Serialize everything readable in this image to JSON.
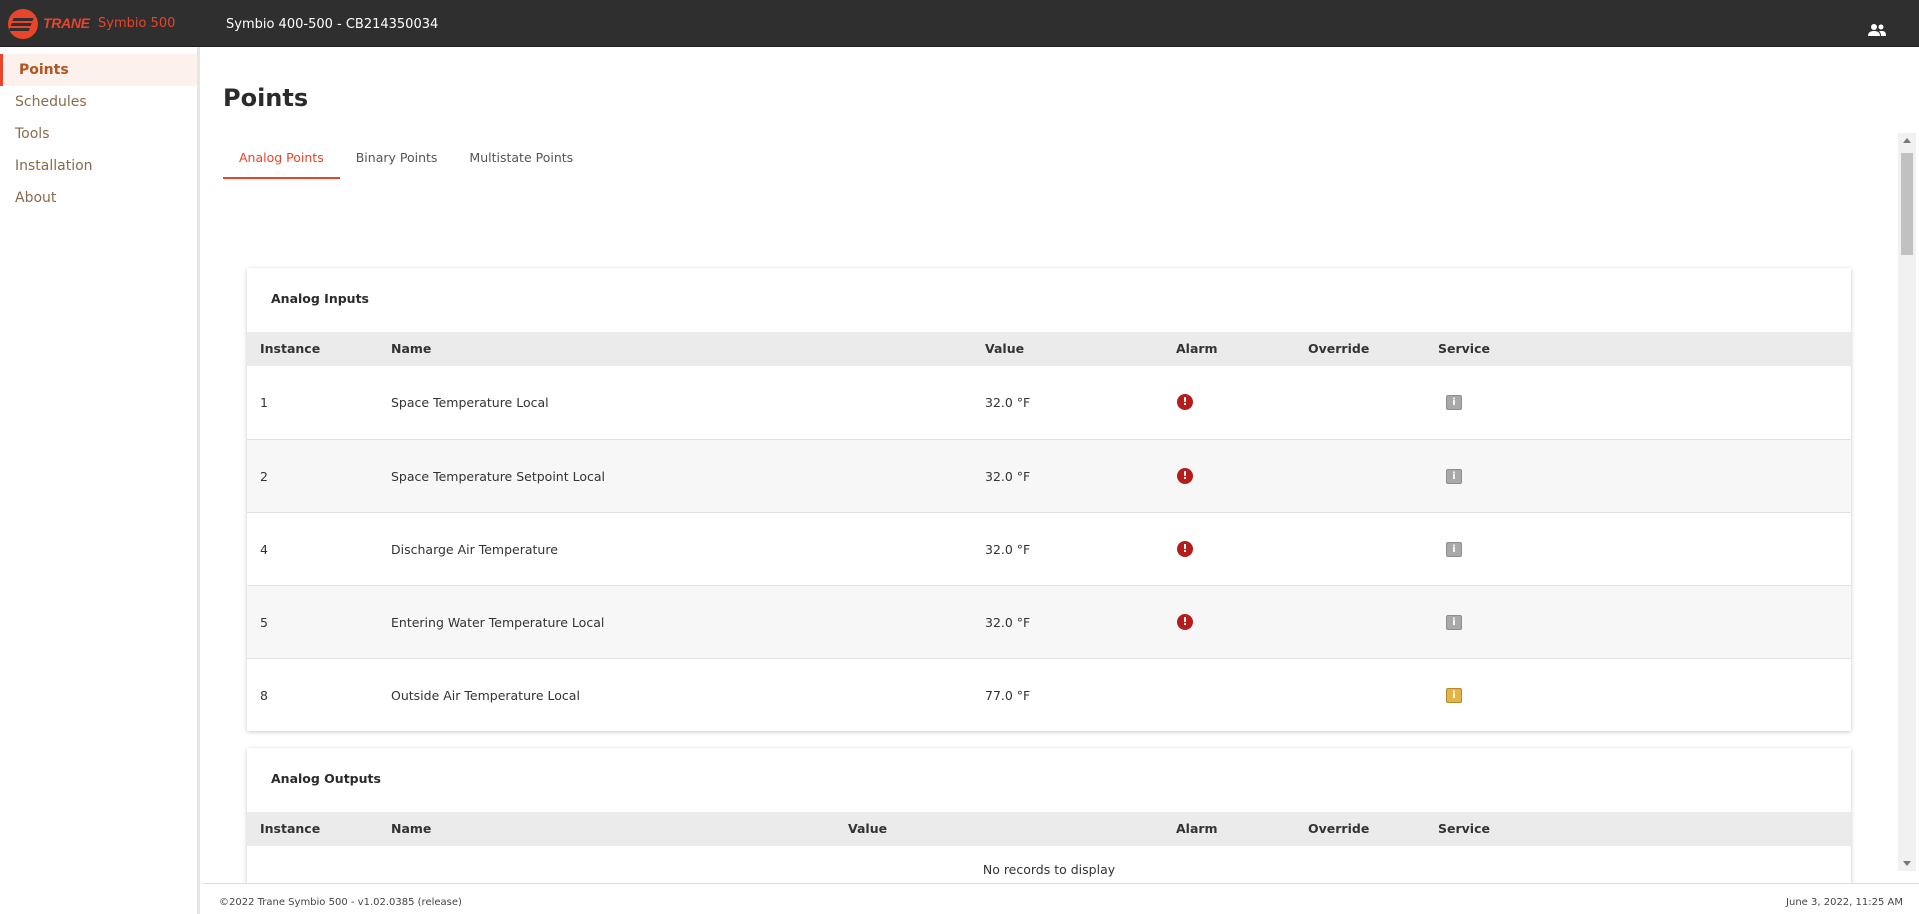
{
  "header": {
    "brand": "TRANE",
    "product": "Symbio 500",
    "device_title": "Symbio 400-500 - CB214350034",
    "user_icon": "user-group-icon"
  },
  "sidebar": {
    "items": [
      {
        "label": "Points",
        "active": true
      },
      {
        "label": "Schedules",
        "active": false
      },
      {
        "label": "Tools",
        "active": false
      },
      {
        "label": "Installation",
        "active": false
      },
      {
        "label": "About",
        "active": false
      }
    ]
  },
  "main": {
    "title": "Points",
    "tabs": [
      {
        "label": "Analog Points",
        "active": true
      },
      {
        "label": "Binary Points",
        "active": false
      },
      {
        "label": "Multistate Points",
        "active": false
      }
    ],
    "analog_inputs": {
      "title": "Analog Inputs",
      "columns": [
        "Instance",
        "Name",
        "Value",
        "Alarm",
        "Override",
        "Service"
      ],
      "rows": [
        {
          "instance": "1",
          "name": "Space Temperature Local",
          "value": "32.0 °F",
          "alarm": true,
          "override": "",
          "service": "info-gray"
        },
        {
          "instance": "2",
          "name": "Space Temperature Setpoint Local",
          "value": "32.0 °F",
          "alarm": true,
          "override": "",
          "service": "info-gray"
        },
        {
          "instance": "4",
          "name": "Discharge Air Temperature",
          "value": "32.0 °F",
          "alarm": true,
          "override": "",
          "service": "info-gray"
        },
        {
          "instance": "5",
          "name": "Entering Water Temperature Local",
          "value": "32.0 °F",
          "alarm": true,
          "override": "",
          "service": "info-gray"
        },
        {
          "instance": "8",
          "name": "Outside Air Temperature Local",
          "value": "77.0 °F",
          "alarm": false,
          "override": "",
          "service": "info-yellow"
        }
      ]
    },
    "analog_outputs": {
      "title": "Analog Outputs",
      "columns": [
        "Instance",
        "Name",
        "Value",
        "Alarm",
        "Override",
        "Service"
      ],
      "empty_text": "No records to display"
    }
  },
  "icons": {
    "alarm": "!",
    "service": "i"
  },
  "colors": {
    "accent": "#e8452a",
    "topbar": "#2f2f2f",
    "alarm": "#b51c1c",
    "service_gray": "#a9a9a9",
    "service_warn": "#e2b546"
  },
  "footer": {
    "copyright": "©2022 Trane Symbio 500 - v1.02.0385 (release)",
    "timestamp": "June 3, 2022, 11:25 AM"
  }
}
